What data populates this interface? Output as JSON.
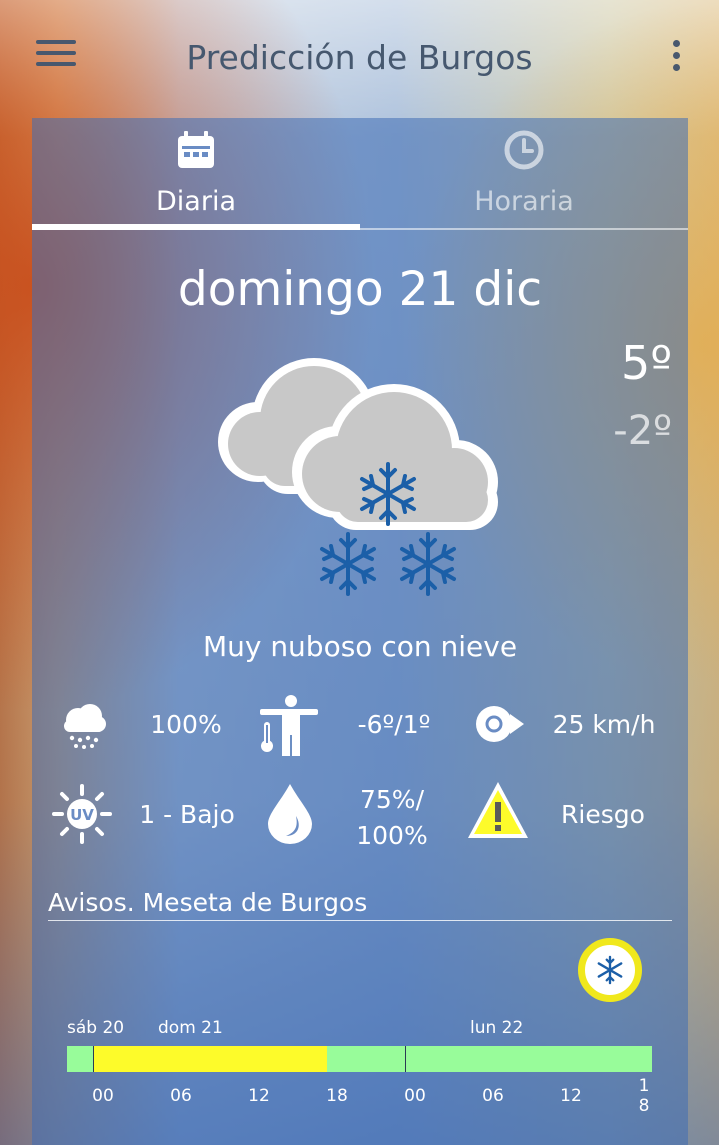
{
  "app": {
    "title": "Predicción de Burgos"
  },
  "tabs": [
    {
      "label": "Diaria",
      "icon": "calendar-icon",
      "active": true
    },
    {
      "label": "Horaria",
      "icon": "clock-icon",
      "active": false
    }
  ],
  "day": {
    "date": "domingo 21 dic",
    "temp_max": "5º",
    "temp_min": "-2º",
    "icon": "cloud-snow-icon",
    "description": "Muy nuboso con nieve"
  },
  "stats": {
    "precip": {
      "icon": "rain-cloud-icon",
      "value": "100%"
    },
    "feels_like": {
      "icon": "person-thermometer-icon",
      "value": "-6º/1º"
    },
    "wind": {
      "icon": "wind-direction-icon",
      "value": "25 km/h"
    },
    "uv": {
      "icon": "uv-sun-icon",
      "value": "1 - Bajo"
    },
    "humidity": {
      "icon": "water-drop-icon",
      "value_line1": "75%/",
      "value_line2": "100%"
    },
    "alert": {
      "icon": "warning-triangle-icon",
      "value": "Riesgo"
    }
  },
  "avisos": {
    "title": "Avisos. Meseta de Burgos",
    "badge_icon": "snowflake-icon",
    "days": [
      "sáb 20",
      "dom 21",
      "lun 22"
    ],
    "hours": [
      "00",
      "06",
      "12",
      "18",
      "00",
      "06",
      "12",
      "1",
      "8"
    ],
    "colors": {
      "green": "#98fc9a",
      "yellow": "#fdfb2a"
    }
  }
}
